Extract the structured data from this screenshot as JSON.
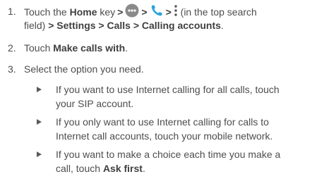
{
  "steps": [
    {
      "number": "1.",
      "line1_a": "Touch the ",
      "line1_home": "Home",
      "line1_b": " key",
      "sep": ">",
      "line1_c": " (in the top search",
      "line2_a": "field) ",
      "line2_settings": "> Settings > Calls > Calling accounts",
      "line2_b": "."
    },
    {
      "number": "2.",
      "text_a": "Touch ",
      "text_bold": "Make calls with",
      "text_b": "."
    },
    {
      "number": "3.",
      "text": "Select the option you need."
    }
  ],
  "bullets": [
    {
      "line1": "If you want to use Internet calling for all calls, touch",
      "line2": "your SIP account."
    },
    {
      "line1": "If you only want to use Internet calling for calls to",
      "line2": "Internet call accounts, touch your mobile network."
    },
    {
      "line1": "If you want to make a choice each time you make a",
      "line2_a": "call, touch ",
      "line2_bold": "Ask first",
      "line2_b": "."
    }
  ],
  "icons": {
    "apps": "apps-icon",
    "phone": "phone-icon",
    "menu": "more-menu-icon"
  },
  "colors": {
    "text": "#4d4d4d",
    "phone_icon": "#2aa3de",
    "apps_icon": "#8a8a8a"
  }
}
